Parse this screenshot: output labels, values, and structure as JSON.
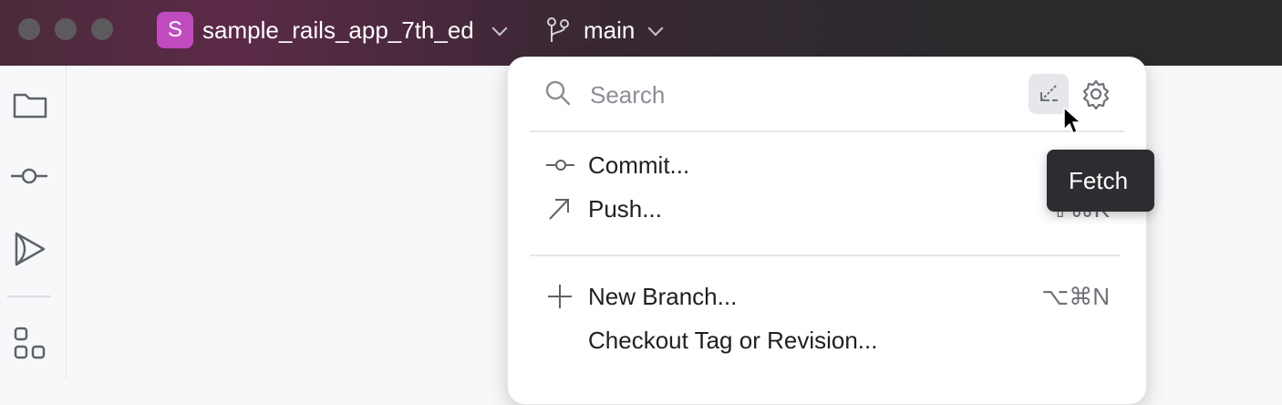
{
  "titlebar": {
    "project": {
      "badge_letter": "S",
      "name": "sample_rails_app_7th_ed",
      "badge_color": "#c04bbf"
    },
    "branch": {
      "name": "main"
    }
  },
  "toolstrip": {
    "items": [
      {
        "icon": "folder-icon"
      },
      {
        "icon": "commit-icon"
      },
      {
        "icon": "run-play-icon"
      },
      {
        "icon": "structure-icon"
      }
    ]
  },
  "popup": {
    "search": {
      "placeholder": "Search",
      "value": ""
    },
    "actions": {
      "fetch_icon": "fetch-icon",
      "settings_icon": "gear-icon"
    },
    "menu": [
      {
        "label": "Commit...",
        "shortcut": "",
        "icon": "commit-icon"
      },
      {
        "label": "Push...",
        "shortcut": "⇧⌘K",
        "icon": "push-arrow-icon"
      },
      {
        "label": "New Branch...",
        "shortcut": "⌥⌘N",
        "icon": "plus-icon"
      },
      {
        "label": "Checkout Tag or Revision...",
        "shortcut": "",
        "icon": ""
      }
    ]
  },
  "tooltip": {
    "text": "Fetch"
  },
  "colors": {
    "accent_badge": "#c04bbf",
    "tooltip_bg": "#2b2d30",
    "popup_bg": "#ffffff"
  }
}
